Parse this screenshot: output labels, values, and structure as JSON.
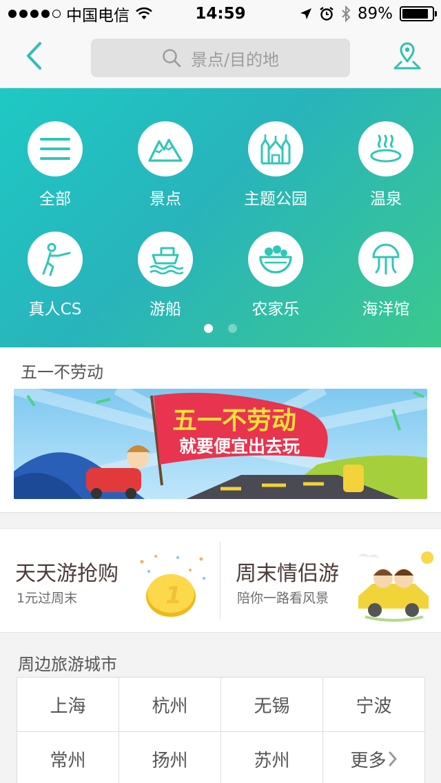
{
  "status_bar": {
    "carrier": "中国电信",
    "time": "14:59",
    "battery": "89%",
    "battery_level": 0.89
  },
  "nav": {
    "search_placeholder": "景点/目的地",
    "accent": "#2cc0b2"
  },
  "categories": [
    {
      "label": "全部",
      "icon": "menu-icon"
    },
    {
      "label": "景点",
      "icon": "mountain-icon"
    },
    {
      "label": "主题公园",
      "icon": "castle-icon"
    },
    {
      "label": "温泉",
      "icon": "hot-spring-icon"
    },
    {
      "label": "真人CS",
      "icon": "shooter-icon"
    },
    {
      "label": "游船",
      "icon": "boat-icon"
    },
    {
      "label": "农家乐",
      "icon": "fruit-bowl-icon"
    },
    {
      "label": "海洋馆",
      "icon": "jellyfish-icon"
    }
  ],
  "pager": {
    "pages": 2,
    "current": 1
  },
  "promo": {
    "title": "五一不劳动",
    "banner_line1": "五一不劳动",
    "banner_line2": "就要便宜出去玩"
  },
  "deals": [
    {
      "title": "天天游抢购",
      "subtitle": "1元过周末"
    },
    {
      "title": "周末情侣游",
      "subtitle": "陪你一路看风景"
    }
  ],
  "cities": {
    "title": "周边旅游城市",
    "items": [
      "上海",
      "杭州",
      "无锡",
      "宁波",
      "常州",
      "扬州",
      "苏州"
    ],
    "more_label": "更多"
  }
}
